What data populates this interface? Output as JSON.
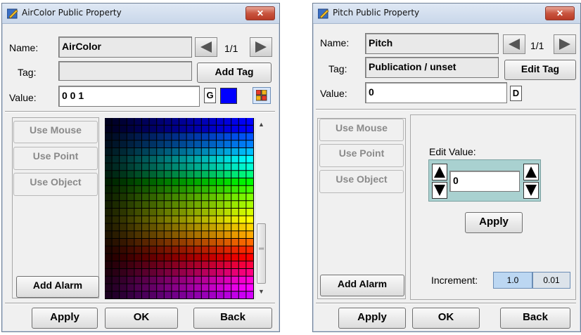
{
  "dialog1": {
    "title": "AirColor Public Property",
    "name_label": "Name:",
    "name_value": "AirColor",
    "counter": "1/1",
    "tag_label": "Tag:",
    "tag_value": "",
    "add_tag_label": "Add Tag",
    "value_label": "Value:",
    "value_value": "0 0 1",
    "type_code": "G",
    "swatch_color": "#0000ff",
    "use_mouse_label": "Use Mouse",
    "use_point_label": "Use Point",
    "use_object_label": "Use Object",
    "add_alarm_label": "Add Alarm",
    "apply_label": "Apply",
    "ok_label": "OK",
    "back_label": "Back"
  },
  "dialog2": {
    "title": "Pitch Public Property",
    "name_label": "Name:",
    "name_value": "Pitch",
    "counter": "1/1",
    "tag_label": "Tag:",
    "tag_value": "Publication / unset",
    "edit_tag_label": "Edit Tag",
    "value_label": "Value:",
    "value_value": "0",
    "type_code": "D",
    "use_mouse_label": "Use Mouse",
    "use_point_label": "Use Point",
    "use_object_label": "Use Object",
    "edit_value_label": "Edit Value:",
    "edit_value": "0",
    "edit_apply_label": "Apply",
    "increment_label": "Increment:",
    "increment_options": [
      "1.0",
      "0.01"
    ],
    "selected_increment": "1.0",
    "add_alarm_label": "Add Alarm",
    "apply_label": "Apply",
    "ok_label": "OK",
    "back_label": "Back"
  },
  "colors": {
    "titlebar": "#c9d7ea",
    "close_button": "#c8553f",
    "edit_area": "#a9d1d0",
    "increment_selected": "#bcd7f2"
  },
  "icons": [
    "pencil-icon",
    "close-icon",
    "left-arrow-icon",
    "right-arrow-icon",
    "color-picker-icon",
    "spin-up-icon",
    "spin-down-icon"
  ]
}
